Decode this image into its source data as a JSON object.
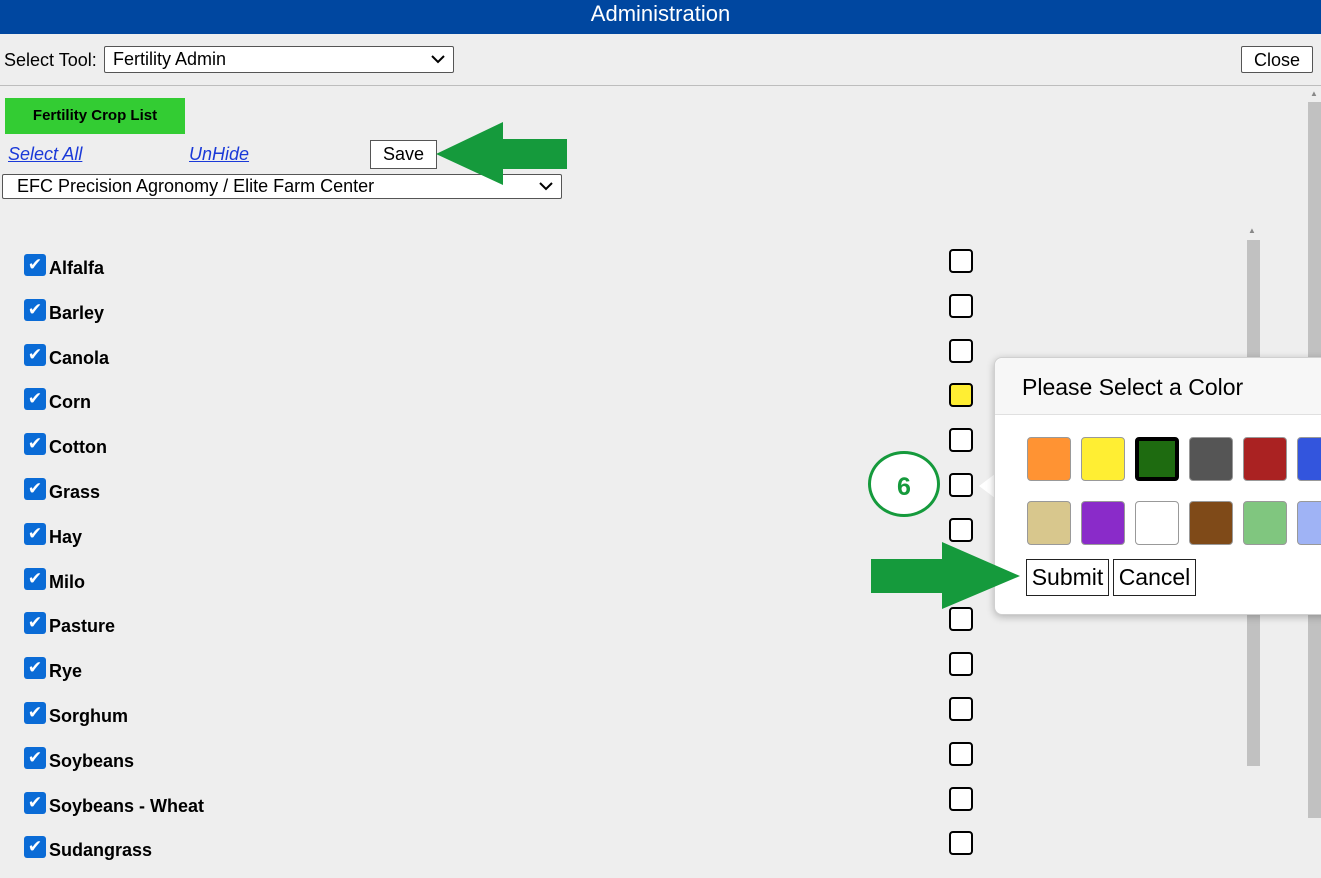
{
  "header": {
    "title": "Administration"
  },
  "toolbar": {
    "select_tool_label": "Select Tool:",
    "select_tool_value": "Fertility Admin",
    "close_label": "Close"
  },
  "crop_panel": {
    "list_button_label": "Fertility Crop List",
    "select_all_label": "Select All",
    "unhide_label": "UnHide",
    "save_label": "Save",
    "company_value": "EFC Precision Agronomy / Elite Farm Center"
  },
  "crops": [
    {
      "name": "Alfalfa",
      "checked": true,
      "color": "#ffffff"
    },
    {
      "name": "Barley",
      "checked": true,
      "color": "#ffffff"
    },
    {
      "name": "Canola",
      "checked": true,
      "color": "#ffffff"
    },
    {
      "name": "Corn",
      "checked": true,
      "color": "#ffee33"
    },
    {
      "name": "Cotton",
      "checked": true,
      "color": "#ffffff"
    },
    {
      "name": "Grass",
      "checked": true,
      "color": "#ffffff"
    },
    {
      "name": "Hay",
      "checked": true,
      "color": "#ffffff"
    },
    {
      "name": "Milo",
      "checked": true,
      "color": "#ffffff"
    },
    {
      "name": "Pasture",
      "checked": true,
      "color": "#ffffff"
    },
    {
      "name": "Rye",
      "checked": true,
      "color": "#ffffff"
    },
    {
      "name": "Sorghum",
      "checked": true,
      "color": "#ffffff"
    },
    {
      "name": "Soybeans",
      "checked": true,
      "color": "#ffffff"
    },
    {
      "name": "Soybeans - Wheat",
      "checked": true,
      "color": "#ffffff"
    },
    {
      "name": "Sudangrass",
      "checked": true,
      "color": "#ffffff"
    }
  ],
  "color_dialog": {
    "title": "Please Select a Color",
    "colors": [
      [
        "#ff9333",
        "#ffee33",
        "#1e6b10",
        "#555555",
        "#aa2222",
        "#3355dd"
      ],
      [
        "#d8c78d",
        "#8a2bc9",
        "#ffffff",
        "#7f4a18",
        "#80c67f",
        "#9fb3f5"
      ]
    ],
    "selected_color": "#1e6b10",
    "submit_label": "Submit",
    "cancel_label": "Cancel"
  },
  "annotation": {
    "step_number": "6",
    "arrow_color": "#159a3c"
  }
}
